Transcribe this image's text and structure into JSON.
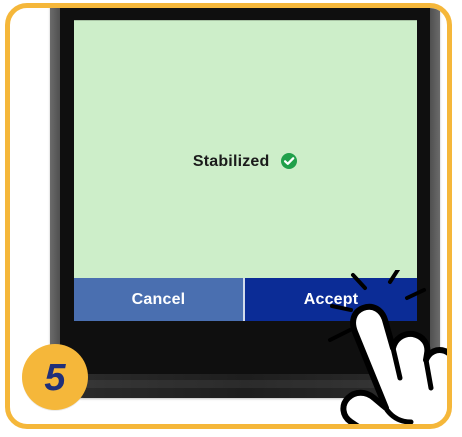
{
  "screen": {
    "status_text": "Stabilized",
    "status_icon": "check-circle-icon",
    "bg_color": "#cdeec9"
  },
  "buttons": {
    "cancel_label": "Cancel",
    "accept_label": "Accept"
  },
  "step": {
    "number": "5",
    "badge_color": "#f5b73a"
  },
  "colors": {
    "frame": "#f5b73a",
    "cancel": "#4a6fb0",
    "accept": "#0b2c96",
    "check": "#20a04a"
  },
  "overlay": {
    "hand_icon": "tap-hand-icon",
    "burst_icon": "tap-burst-icon"
  }
}
